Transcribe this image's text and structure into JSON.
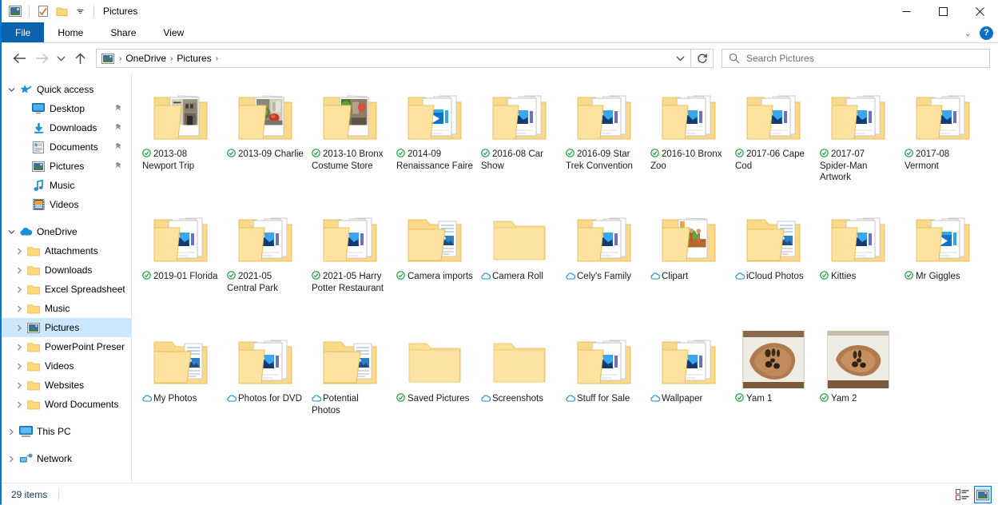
{
  "window": {
    "title": "Pictures",
    "quick_access_icons": [
      "pictures-icon",
      "properties-icon",
      "new-folder-icon",
      "customize-qat-chevron"
    ],
    "minimize_label": "—",
    "maximize_label": "☐",
    "close_label": "✕"
  },
  "ribbon": {
    "tabs": [
      {
        "label": "File",
        "active_style": "file"
      },
      {
        "label": "Home"
      },
      {
        "label": "Share"
      },
      {
        "label": "View"
      }
    ],
    "collapse_label": "⌄",
    "help_label": "?"
  },
  "address": {
    "back_tooltip": "Back",
    "forward_tooltip": "Forward",
    "recent_tooltip": "Recent locations",
    "up_tooltip": "Up",
    "crumbs": [
      "OneDrive",
      "Pictures"
    ],
    "crumb_sep": "›",
    "dropdown_label": "⌄",
    "refresh_label": "↻"
  },
  "search": {
    "placeholder": "Search Pictures",
    "value": ""
  },
  "nav": {
    "items": [
      {
        "label": "Quick access",
        "icon": "star-pin-icon",
        "level": 0,
        "expander": "down",
        "selected": false,
        "pinned": false
      },
      {
        "label": "Desktop",
        "icon": "desktop-icon",
        "level": 1,
        "expander": "",
        "selected": false,
        "pinned": true
      },
      {
        "label": "Downloads",
        "icon": "download-arrow-icon",
        "level": 1,
        "expander": "",
        "selected": false,
        "pinned": true
      },
      {
        "label": "Documents",
        "icon": "document-icon",
        "level": 1,
        "expander": "",
        "selected": false,
        "pinned": true
      },
      {
        "label": "Pictures",
        "icon": "pictures-icon",
        "level": 1,
        "expander": "",
        "selected": false,
        "pinned": true
      },
      {
        "label": "Music",
        "icon": "music-note-icon",
        "level": 1,
        "expander": "",
        "selected": false,
        "pinned": false
      },
      {
        "label": "Videos",
        "icon": "video-film-icon",
        "level": 1,
        "expander": "",
        "selected": false,
        "pinned": false
      },
      {
        "label": "OneDrive",
        "icon": "cloud-icon",
        "level": 0,
        "expander": "down",
        "selected": false,
        "pinned": false,
        "gap_before": true
      },
      {
        "label": "Attachments",
        "icon": "folder-icon",
        "level": 1,
        "expander": "right",
        "selected": false,
        "pinned": false
      },
      {
        "label": "Downloads",
        "icon": "folder-icon",
        "level": 1,
        "expander": "right",
        "selected": false,
        "pinned": false
      },
      {
        "label": "Excel Spreadsheets",
        "icon": "folder-icon",
        "level": 1,
        "expander": "right",
        "selected": false,
        "pinned": false
      },
      {
        "label": "Music",
        "icon": "folder-icon",
        "level": 1,
        "expander": "right",
        "selected": false,
        "pinned": false
      },
      {
        "label": "Pictures",
        "icon": "pictures-icon",
        "level": 1,
        "expander": "right",
        "selected": true,
        "pinned": false
      },
      {
        "label": "PowerPoint Present",
        "icon": "folder-icon",
        "level": 1,
        "expander": "right",
        "selected": false,
        "pinned": false
      },
      {
        "label": "Videos",
        "icon": "folder-icon",
        "level": 1,
        "expander": "right",
        "selected": false,
        "pinned": false
      },
      {
        "label": "Websites",
        "icon": "folder-icon",
        "level": 1,
        "expander": "right",
        "selected": false,
        "pinned": false
      },
      {
        "label": "Word Documents",
        "icon": "folder-icon",
        "level": 1,
        "expander": "right",
        "selected": false,
        "pinned": false
      },
      {
        "label": "This PC",
        "icon": "this-pc-icon",
        "level": 0,
        "expander": "right",
        "selected": false,
        "pinned": false,
        "gap_before": true
      },
      {
        "label": "Network",
        "icon": "network-icon",
        "level": 0,
        "expander": "right",
        "selected": false,
        "pinned": false,
        "gap_before": true
      }
    ]
  },
  "files": {
    "items": [
      {
        "name": "2013-08 Newport Trip",
        "kind": "folder",
        "thumb": "photo-building",
        "sync": "synced"
      },
      {
        "name": "2013-09 Charlie",
        "kind": "folder",
        "thumb": "photo-kitchen",
        "sync": "synced"
      },
      {
        "name": "2013-10 Bronx Costume Store",
        "kind": "folder",
        "thumb": "photo-costume",
        "sync": "synced"
      },
      {
        "name": "2014-09 Renaissance Faire",
        "kind": "folder",
        "thumb": "media-video",
        "sync": "synced"
      },
      {
        "name": "2016-08 Car Show",
        "kind": "folder",
        "thumb": "media-image",
        "sync": "synced"
      },
      {
        "name": "2016-09 Star Trek Convention",
        "kind": "folder",
        "thumb": "media-image",
        "sync": "synced"
      },
      {
        "name": "2016-10 Bronx Zoo",
        "kind": "folder",
        "thumb": "media-image",
        "sync": "synced"
      },
      {
        "name": "2017-06 Cape Cod",
        "kind": "folder",
        "thumb": "media-image",
        "sync": "synced"
      },
      {
        "name": "2017-07 Spider-Man Artwork",
        "kind": "folder",
        "thumb": "media-image",
        "sync": "synced"
      },
      {
        "name": "2017-08 Vermont",
        "kind": "folder",
        "thumb": "media-image",
        "sync": "synced"
      },
      {
        "name": "2019-01 Florida",
        "kind": "folder",
        "thumb": "media-image",
        "sync": "synced"
      },
      {
        "name": "2021-05 Central Park",
        "kind": "folder",
        "thumb": "media-image",
        "sync": "synced"
      },
      {
        "name": "2021-05 Harry Potter Restaurant",
        "kind": "folder",
        "thumb": "media-image",
        "sync": "synced"
      },
      {
        "name": "Camera imports",
        "kind": "folder",
        "thumb": "doc-photo-stack",
        "sync": "synced"
      },
      {
        "name": "Camera Roll",
        "kind": "folder",
        "thumb": "empty",
        "sync": "online"
      },
      {
        "name": "Cely's Family",
        "kind": "folder",
        "thumb": "media-image",
        "sync": "online"
      },
      {
        "name": "Clipart",
        "kind": "folder",
        "thumb": "photo-clipart",
        "sync": "online"
      },
      {
        "name": "iCloud Photos",
        "kind": "folder",
        "thumb": "doc-photo-stack",
        "sync": "online"
      },
      {
        "name": "Kitties",
        "kind": "folder",
        "thumb": "media-image",
        "sync": "synced"
      },
      {
        "name": "Mr Giggles",
        "kind": "folder",
        "thumb": "media-video",
        "sync": "synced"
      },
      {
        "name": "My Photos",
        "kind": "folder",
        "thumb": "doc-photo-stack",
        "sync": "online"
      },
      {
        "name": "Photos for DVD",
        "kind": "folder",
        "thumb": "media-image",
        "sync": "online"
      },
      {
        "name": "Potential Photos",
        "kind": "folder",
        "thumb": "doc-photo-stack",
        "sync": "online"
      },
      {
        "name": "Saved Pictures",
        "kind": "folder",
        "thumb": "empty",
        "sync": "synced"
      },
      {
        "name": "Screenshots",
        "kind": "folder",
        "thumb": "empty",
        "sync": "online"
      },
      {
        "name": "Stuff for Sale",
        "kind": "folder",
        "thumb": "media-image",
        "sync": "online"
      },
      {
        "name": "Wallpaper",
        "kind": "folder",
        "thumb": "media-image",
        "sync": "online"
      },
      {
        "name": "Yam 1",
        "kind": "photo",
        "thumb": "photo-yam1",
        "sync": "synced"
      },
      {
        "name": "Yam 2",
        "kind": "photo",
        "thumb": "photo-yam2",
        "sync": "synced"
      }
    ]
  },
  "status": {
    "item_count": "29 items",
    "view_details_label": "Details view",
    "view_large_icons_label": "Large icons view",
    "active_view": "large-icons"
  },
  "colors": {
    "accent": "#0078d7",
    "file_tab": "#0b63ad",
    "folder": "#ffd87a",
    "sync_ok": "#1a9e3c",
    "sync_cloud": "#1a8fd1",
    "selection": "#cce8ff"
  }
}
